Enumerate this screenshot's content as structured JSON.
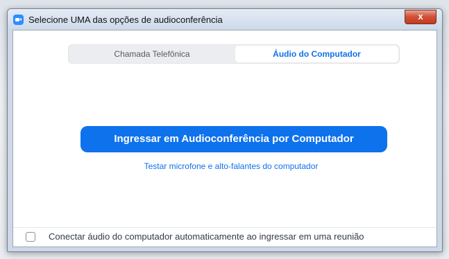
{
  "window": {
    "title": "Selecione UMA das opções de audioconferência",
    "close_label": "x"
  },
  "tabs": [
    {
      "label": "Chamada Telefônica",
      "selected": false
    },
    {
      "label": "Áudio do Computador",
      "selected": true
    }
  ],
  "main": {
    "join_button_label": "Ingressar em Audioconferência por Computador",
    "test_link_label": "Testar microfone e alto-falantes do computador"
  },
  "footer": {
    "auto_connect_label": "Conectar áudio do computador automaticamente ao ingressar em uma reunião",
    "auto_connect_checked": false
  },
  "colors": {
    "accent": "#0e72ed",
    "link": "#0e71eb",
    "close_button": "#c23a20"
  }
}
